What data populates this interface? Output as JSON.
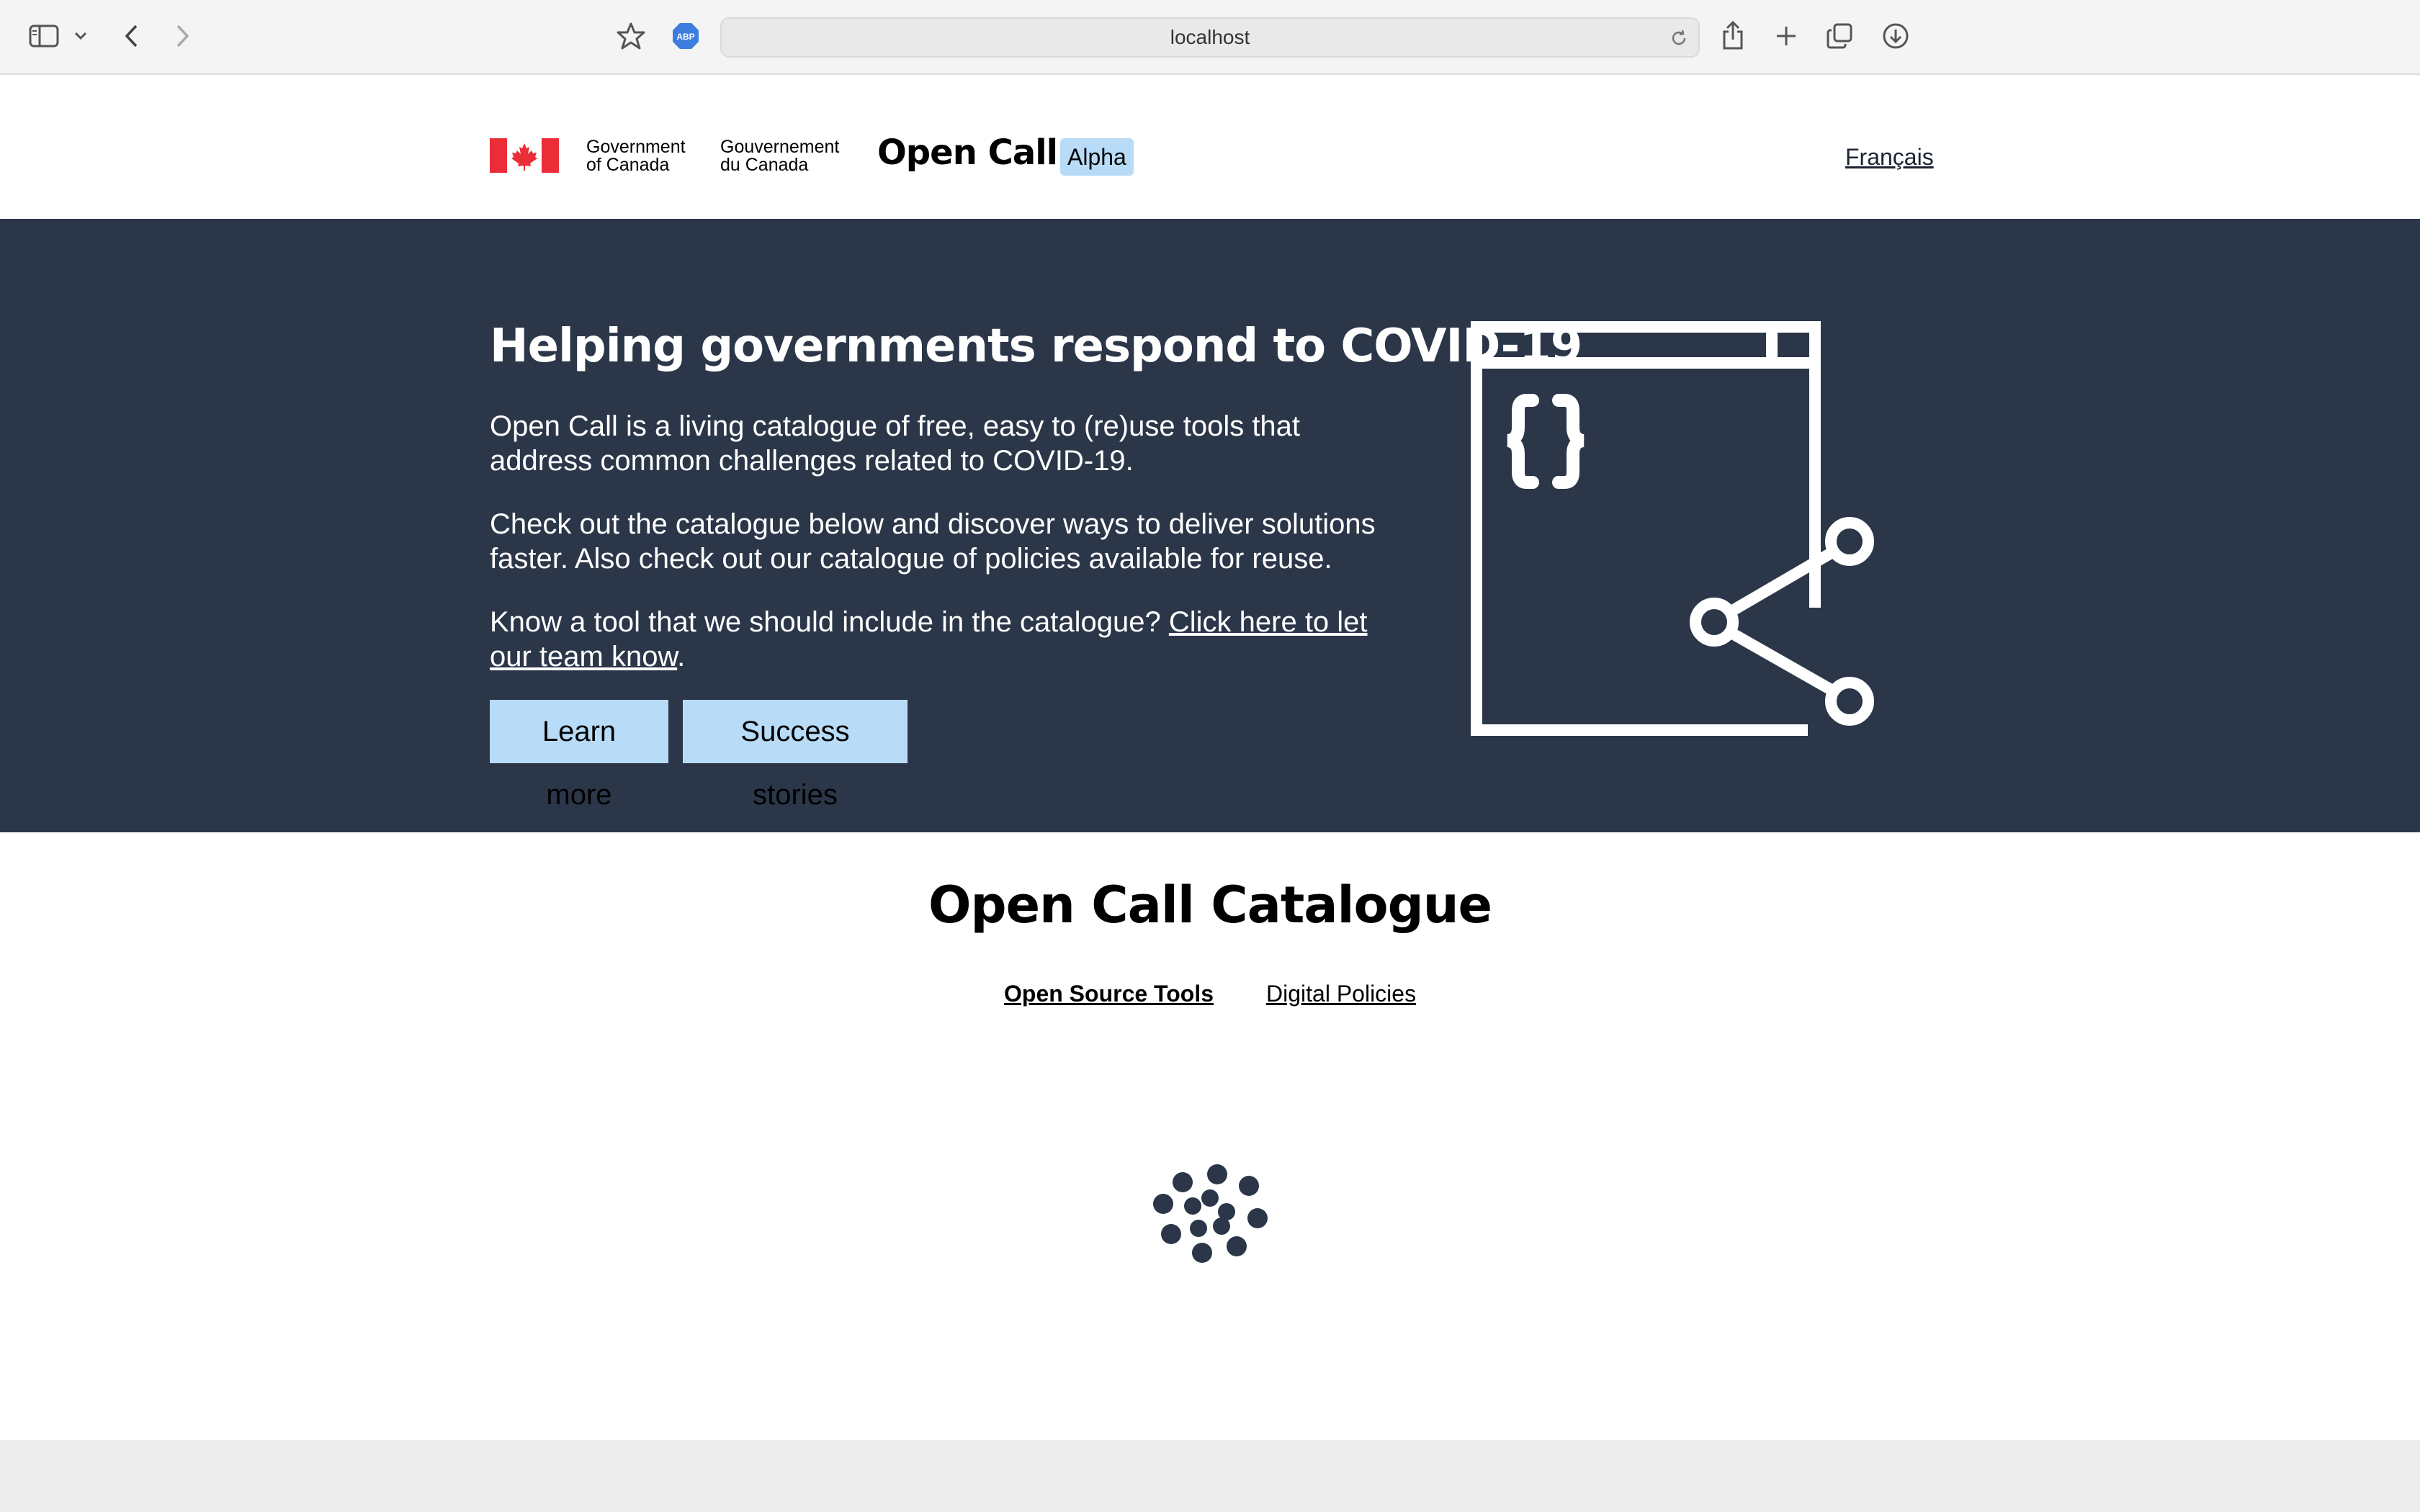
{
  "browser": {
    "url": "localhost",
    "adblock_badge": "ABP",
    "icons": [
      "sidebar-icon",
      "chevron-down-icon",
      "back-icon",
      "forward-icon",
      "bookmark-star-icon",
      "adblock-icon",
      "reload-icon",
      "share-icon",
      "new-tab-icon",
      "tabs-overview-icon",
      "download-icon"
    ]
  },
  "header": {
    "gov_en_line1": "Government",
    "gov_en_line2": "of Canada",
    "gov_fr_line1": "Gouvernement",
    "gov_fr_line2": "du Canada",
    "site_title": "Open Call",
    "badge": "Alpha",
    "language_link": "Français"
  },
  "hero": {
    "title": "Helping governments respond to COVID-19",
    "paragraph1": "Open Call is a living catalogue of free, easy to (re)use tools that address common challenges related to COVID-19.",
    "paragraph2": "Check out the catalogue below and discover ways to deliver solutions faster. Also check out our catalogue of policies available for reuse.",
    "paragraph3_prefix": "Know a tool that we should include in the catalogue? ",
    "paragraph3_link": "Click here to let our team know",
    "paragraph3_suffix": ".",
    "learn_more": "Learn more",
    "success_stories": "Success stories",
    "illustration": "code-share-icon"
  },
  "catalogue": {
    "title": "Open Call Catalogue",
    "tabs": [
      {
        "label": "Open Source Tools",
        "active": true
      },
      {
        "label": "Digital Policies",
        "active": false
      }
    ],
    "loading_indicator": "spinner-icon"
  },
  "colors": {
    "hero_bg": "#2b3649",
    "button_bg": "#b8dcf8",
    "flag_red": "#eb2d37",
    "footer_bg": "#ececec"
  }
}
